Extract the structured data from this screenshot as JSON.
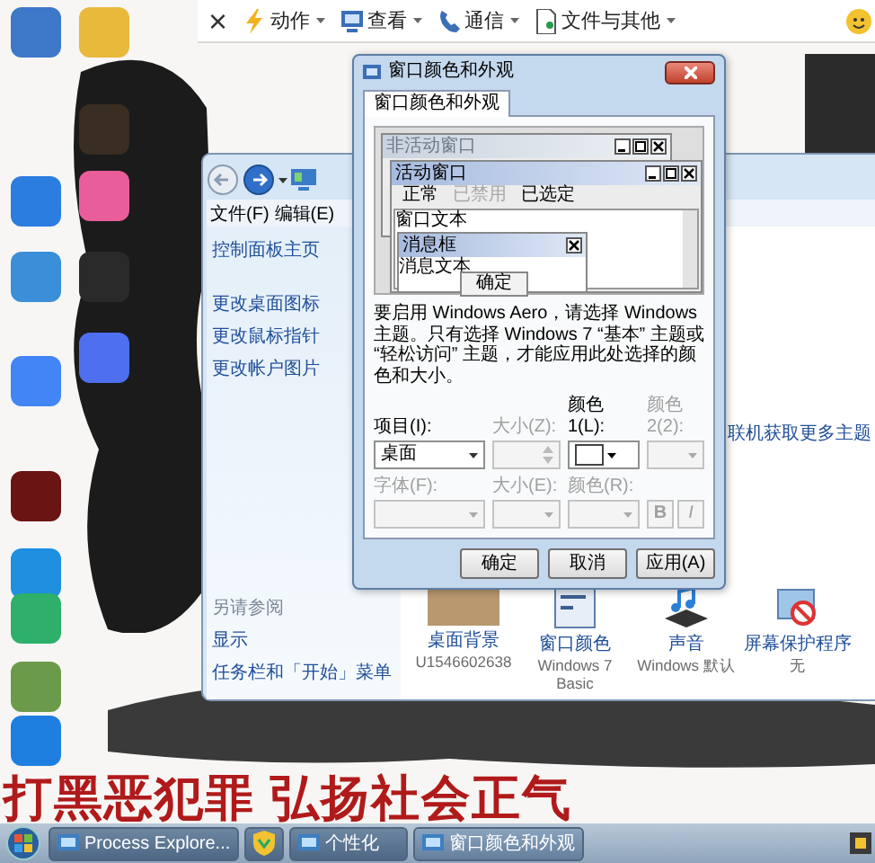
{
  "toolbar": {
    "close": "×",
    "menus": [
      {
        "kind": "bolt",
        "label": "动作"
      },
      {
        "kind": "monitor",
        "label": "查看"
      },
      {
        "kind": "phone",
        "label": "通信"
      },
      {
        "kind": "document",
        "label": "文件与其他"
      }
    ]
  },
  "personalization_window": {
    "menu": [
      "文件(F)",
      "编辑(E)"
    ],
    "sidebar_links": [
      "控制面板主页",
      "更改桌面图标",
      "更改鼠标指针",
      "更改帐户图片"
    ],
    "see_also_title": "另请参阅",
    "see_also_links": [
      "显示",
      "任务栏和「开始」菜单"
    ],
    "online_link": "联机获取更多主题",
    "items": [
      {
        "kind": "background",
        "label": "桌面背景",
        "value": "U1546602638"
      },
      {
        "kind": "window-color",
        "label": "窗口颜色",
        "value": "Windows 7 Basic"
      },
      {
        "kind": "sound",
        "label": "声音",
        "value": "Windows 默认"
      },
      {
        "kind": "screensaver",
        "label": "屏幕保护程序",
        "value": "无"
      }
    ]
  },
  "dialog": {
    "title": "窗口颜色和外观",
    "tabs": [
      {
        "label": "窗口颜色和外观",
        "selected": true
      }
    ],
    "preview": {
      "inactive_title": "非活动窗口",
      "active_title": "活动窗口",
      "menu": [
        {
          "label": "正常",
          "disabled": false
        },
        {
          "label": "已禁用",
          "disabled": true
        },
        {
          "label": "已选定",
          "disabled": false
        }
      ],
      "window_text": "窗口文本",
      "message_title": "消息框",
      "message_text": "消息文本",
      "ok": "确定"
    },
    "description": "要启用 Windows Aero，请选择 Windows 主题。只有选择 Windows 7 “基本” 主题或 “轻松访问” 主题，才能应用此处选择的颜色和大小。",
    "fields": [
      {
        "kind": "select",
        "label": "项目(I):",
        "value": "桌面",
        "disabled": false
      },
      {
        "kind": "spinner",
        "label": "大小(Z):",
        "disabled": true
      },
      {
        "kind": "color",
        "label": "颜色 1(L):",
        "disabled": false
      },
      {
        "kind": "color",
        "label": "颜色 2(2):",
        "disabled": true
      },
      {
        "kind": "select",
        "label": "字体(F):",
        "disabled": true
      },
      {
        "kind": "select",
        "label": "大小(E):",
        "disabled": true
      },
      {
        "kind": "color",
        "label": "颜色(R):",
        "disabled": true
      },
      {
        "kind": "style",
        "bold": "B",
        "italic": "I",
        "disabled": true
      }
    ],
    "buttons": [
      "确定",
      "取消",
      "应用(A)"
    ]
  },
  "banner": "打黑恶犯罪 弘扬社会正气",
  "taskbar": {
    "items": [
      {
        "kind": "app",
        "label": "Process Explore...",
        "selected": false
      },
      {
        "kind": "shield",
        "selected": false
      },
      {
        "kind": "app",
        "label": "个性化",
        "selected": false
      },
      {
        "kind": "app",
        "label": "窗口颜色和外观",
        "selected": true
      }
    ]
  }
}
